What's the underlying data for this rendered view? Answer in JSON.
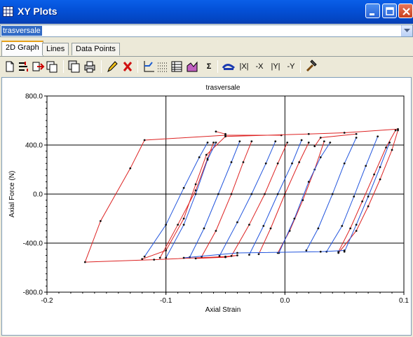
{
  "window": {
    "title": "XY Plots",
    "buttons": [
      "minimize",
      "maximize",
      "close"
    ]
  },
  "selector": {
    "value": "trasversale"
  },
  "tabs": [
    {
      "label": "2D Graph",
      "active": true
    },
    {
      "label": "Lines",
      "active": false
    },
    {
      "label": "Data Points",
      "active": false
    }
  ],
  "toolbar": {
    "sigma_label": "Σ",
    "abs_x_label": "|X|",
    "neg_x_label": "-X",
    "abs_y_label": "|Y|",
    "neg_y_label": "-Y"
  },
  "chart_data": {
    "type": "line",
    "title": "trasversale",
    "xlabel": "Axial Strain",
    "ylabel": "Axial Force (N)",
    "xlim": [
      -0.2,
      0.1
    ],
    "ylim": [
      -800,
      800
    ],
    "xticks": [
      "-0.2",
      "-0.1",
      "0.0",
      "0.1"
    ],
    "yticks": [
      "800.0",
      "400.0",
      "0.0",
      "-400.0",
      "-800.0"
    ],
    "grid": false,
    "colors": {
      "red": "#dd2222",
      "blue": "#2255dd",
      "marker": "#111111"
    },
    "series": [
      {
        "color": "red",
        "points": [
          [
            -0.003,
            480
          ],
          [
            -0.05,
            480
          ],
          [
            -0.118,
            440
          ],
          [
            -0.13,
            210
          ],
          [
            -0.155,
            -220
          ],
          [
            -0.168,
            -555
          ],
          [
            -0.11,
            -535
          ],
          [
            -0.05,
            -510
          ],
          [
            -0.04,
            -500
          ],
          [
            -0.05,
            -515
          ],
          [
            -0.075,
            -525
          ]
        ]
      },
      {
        "color": "red",
        "points": [
          [
            -0.12,
            -530
          ],
          [
            -0.1,
            -460
          ],
          [
            -0.085,
            -200
          ],
          [
            -0.075,
            80
          ],
          [
            -0.066,
            320
          ],
          [
            -0.05,
            470
          ],
          [
            0.02,
            490
          ],
          [
            0.05,
            500
          ],
          [
            0.095,
            530
          ]
        ]
      },
      {
        "color": "red",
        "points": [
          [
            0.045,
            -480
          ],
          [
            0.06,
            -300
          ],
          [
            0.07,
            -100
          ],
          [
            0.08,
            120
          ],
          [
            0.09,
            360
          ],
          [
            0.095,
            520
          ]
        ]
      },
      {
        "color": "red",
        "points": [
          [
            -0.105,
            -520
          ],
          [
            -0.09,
            -250
          ],
          [
            -0.075,
            30
          ],
          [
            -0.065,
            290
          ],
          [
            -0.06,
            420
          ]
        ]
      },
      {
        "color": "red",
        "points": [
          [
            -0.07,
            -510
          ],
          [
            -0.058,
            -300
          ],
          [
            -0.045,
            0
          ],
          [
            -0.035,
            260
          ],
          [
            -0.028,
            430
          ]
        ]
      },
      {
        "color": "red",
        "points": [
          [
            -0.045,
            -505
          ],
          [
            -0.03,
            -250
          ],
          [
            -0.017,
            0
          ],
          [
            -0.006,
            250
          ],
          [
            0.002,
            420
          ]
        ]
      },
      {
        "color": "red",
        "points": [
          [
            -0.022,
            -490
          ],
          [
            -0.012,
            -280
          ],
          [
            0.0,
            0
          ],
          [
            0.012,
            260
          ],
          [
            0.02,
            420
          ]
        ]
      },
      {
        "color": "red",
        "points": [
          [
            -0.006,
            -480
          ],
          [
            0.004,
            -300
          ],
          [
            0.015,
            -50
          ],
          [
            0.025,
            200
          ],
          [
            0.033,
            430
          ]
        ]
      },
      {
        "color": "red",
        "points": [
          [
            0.045,
            -470
          ],
          [
            0.055,
            -280
          ],
          [
            0.065,
            -60
          ],
          [
            0.075,
            160
          ],
          [
            0.085,
            380
          ],
          [
            0.093,
            520
          ]
        ]
      },
      {
        "color": "red",
        "points": [
          [
            -0.058,
            510
          ],
          [
            -0.05,
            490
          ]
        ]
      },
      {
        "color": "red",
        "points": [
          [
            0.025,
            390
          ],
          [
            0.03,
            460
          ],
          [
            0.06,
            490
          ]
        ]
      },
      {
        "color": "blue",
        "points": [
          [
            -0.118,
            -510
          ],
          [
            -0.1,
            -250
          ],
          [
            -0.085,
            50
          ],
          [
            -0.072,
            300
          ],
          [
            -0.065,
            420
          ]
        ]
      },
      {
        "color": "blue",
        "points": [
          [
            -0.1,
            -520
          ],
          [
            -0.085,
            -250
          ],
          [
            -0.075,
            0
          ],
          [
            -0.065,
            280
          ],
          [
            -0.058,
            420
          ]
        ]
      },
      {
        "color": "blue",
        "points": [
          [
            -0.08,
            -515
          ],
          [
            -0.068,
            -280
          ],
          [
            -0.056,
            0
          ],
          [
            -0.045,
            260
          ],
          [
            -0.038,
            430
          ]
        ]
      },
      {
        "color": "blue",
        "points": [
          [
            -0.055,
            -505
          ],
          [
            -0.04,
            -230
          ],
          [
            -0.028,
            0
          ],
          [
            -0.016,
            250
          ],
          [
            -0.008,
            430
          ]
        ]
      },
      {
        "color": "blue",
        "points": [
          [
            -0.03,
            -495
          ],
          [
            -0.018,
            -260
          ],
          [
            -0.006,
            0
          ],
          [
            0.006,
            250
          ],
          [
            0.014,
            440
          ]
        ]
      },
      {
        "color": "blue",
        "points": [
          [
            0.018,
            -460
          ],
          [
            0.028,
            -280
          ],
          [
            0.04,
            0
          ],
          [
            0.05,
            250
          ],
          [
            0.06,
            460
          ]
        ]
      },
      {
        "color": "blue",
        "points": [
          [
            0.035,
            -470
          ],
          [
            0.048,
            -260
          ],
          [
            0.058,
            -20
          ],
          [
            0.068,
            230
          ],
          [
            0.078,
            470
          ]
        ]
      },
      {
        "color": "blue",
        "points": [
          [
            0.05,
            -470
          ],
          [
            0.06,
            -250
          ],
          [
            0.07,
            -20
          ],
          [
            0.08,
            220
          ],
          [
            0.088,
            420
          ]
        ]
      },
      {
        "color": "blue",
        "points": [
          [
            -0.005,
            -480
          ],
          [
            0.008,
            -200
          ],
          [
            0.02,
            100
          ],
          [
            0.03,
            300
          ],
          [
            0.038,
            420
          ]
        ]
      },
      {
        "color": "blue",
        "points": [
          [
            -0.085,
            -520
          ],
          [
            -0.04,
            -480
          ],
          [
            0.03,
            -470
          ],
          [
            0.05,
            -460
          ]
        ]
      }
    ]
  }
}
